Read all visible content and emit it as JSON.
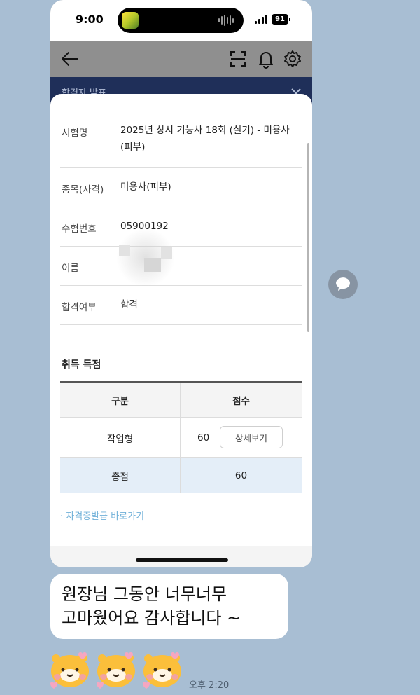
{
  "status_bar": {
    "time": "9:00",
    "battery": "91"
  },
  "banner": {
    "text": "합격자 발표"
  },
  "result": {
    "rows": [
      {
        "label": "시험명",
        "value_line1": "2025년 상시 기능사 18회 (실기) - 미용사",
        "value_line2": "(피부)"
      },
      {
        "label": "종목(자격)",
        "value": "미용사(피부)"
      },
      {
        "label": "수험번호",
        "value": "05900192"
      },
      {
        "label": "이름",
        "value": ""
      },
      {
        "label": "합격여부",
        "value": "합격"
      }
    ]
  },
  "scores": {
    "title": "취득 득점",
    "headers": [
      "구분",
      "점수"
    ],
    "rows": [
      {
        "category": "작업형",
        "score": "60",
        "button": "상세보기"
      },
      {
        "category": "총점",
        "score": "60"
      }
    ]
  },
  "certificate_link": "· 자격증발급 바로가기",
  "chat": {
    "message_line1": "원장님 그동안 너무너무",
    "message_line2": "고마웠어요 감사합니다 ~",
    "time": "오후 2:20"
  },
  "icons": [
    "back-arrow-icon",
    "scan-icon",
    "bell-icon",
    "gear-icon",
    "close-icon",
    "share-icon",
    "emoticon"
  ],
  "colors": {
    "chat_bg": "#a8bed3",
    "banner_bg": "#1f2f59",
    "total_row_bg": "#e4eef8",
    "link": "#6fb0d8"
  }
}
